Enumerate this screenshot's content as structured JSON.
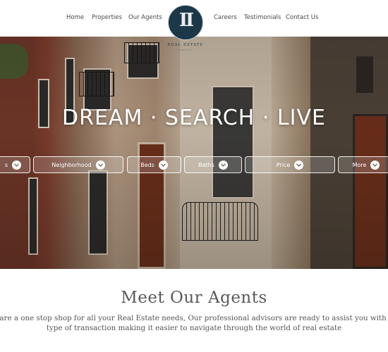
{
  "nav": {
    "left": [
      "Home",
      "Properties",
      "Our Agents"
    ],
    "right": [
      "Careers",
      "Testimonials",
      "Contact Us"
    ]
  },
  "logo": {
    "mark": "II",
    "name": "REAL ESTATE",
    "sub": "GROUP LLC"
  },
  "hero": {
    "tagline": "DREAM · SEARCH · LIVE",
    "filters": [
      "s",
      "Neighborhood",
      "Beds",
      "Baths",
      "Price",
      "More"
    ]
  },
  "agents": {
    "title": "Meet Our Agents",
    "description": "We are a one stop shop for all your Real Estate needs, Our professional advisors are ready to assist you with any type of transaction making it easier to navigate through the world of real estate"
  },
  "colors": {
    "logo_bg": "#1c3848",
    "nav_text": "#4a4a4a",
    "heading_text": "#5a5a5a"
  }
}
